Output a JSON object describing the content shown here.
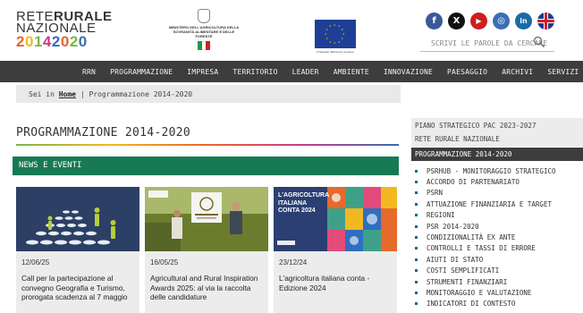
{
  "logo": {
    "line1a": "RETE",
    "line1b": "RURALE",
    "line2": "NAZIONALE",
    "digits": [
      "2",
      "0",
      "1",
      "4",
      "2",
      "0",
      "2",
      "0"
    ],
    "digit_colors": [
      "#e8662a",
      "#f2b821",
      "#7ab648",
      "#c83c8c",
      "#3a6cb4",
      "#e8662a",
      "#7ab648",
      "#3a6cb4"
    ]
  },
  "ministry": {
    "text": "MINISTERO DELL'AGRICOLTURA DELLA SOVRANITÀ ALIMENTARE E DELLE FORESTE"
  },
  "eu": {
    "caption": "Finanziato dall'Unione europea"
  },
  "social": {
    "facebook": "f",
    "x": "X",
    "youtube": "▶",
    "instagram": "◎",
    "linkedin": "in"
  },
  "search": {
    "placeholder": "SCRIVI LE PAROLE DA CERCARE"
  },
  "nav": [
    "RRN",
    "PROGRAMMAZIONE",
    "IMPRESA",
    "TERRITORIO",
    "LEADER",
    "AMBIENTE",
    "INNOVAZIONE",
    "PAESAGGIO",
    "ARCHIVI",
    "SERVIZI"
  ],
  "breadcrumb": {
    "prefix": "Sei in",
    "home": "Home",
    "current": "Programmazione 2014-2020"
  },
  "page_title": "PROGRAMMAZIONE 2014-2020",
  "news_header": "NEWS E EVENTI",
  "cards": [
    {
      "date": "12/06/25",
      "title": "Call per la partecipazione al convegno Geografia e Turismo, prorogata scadenza al 7 maggio"
    },
    {
      "date": "16/05/25",
      "title": "Agricultural and Rural Inspiration Awards 2025: al via la raccolta delle candidature",
      "badge": "ARIA"
    },
    {
      "date": "23/12/24",
      "title": "L'agricoltura italiana conta - Edizione 2024",
      "img_title": "L'AGRICOLTURA ITALIANA CONTA 2024"
    }
  ],
  "sidebar": {
    "top_links": [
      "PIANO STRATEGICO PAC 2023-2027",
      "RETE RURALE NAZIONALE"
    ],
    "section": "PROGRAMMAZIONE 2014-2020",
    "items": [
      "PSRHUB - MONITORAGGIO STRATEGICO",
      "ACCORDO DI PARTENARIATO",
      "PSRN",
      "ATTUAZIONE FINANZIARIA E TARGET",
      "REGIONI",
      "PSR 2014-2020",
      "CONDIZIONALITÀ EX ANTE",
      "CONTROLLI E TASSI DI ERRORE",
      "AIUTI DI STATO",
      "COSTI SEMPLIFICATI",
      "STRUMENTI FINANZIARI",
      "MONITORAGGIO E VALUTAZIONE",
      "INDICATORI DI CONTESTO"
    ]
  },
  "colors": {
    "nav_bg": "#3d3d3d",
    "news_bar": "#177a55",
    "facebook": "#3b5998",
    "x": "#111111",
    "youtube": "#cc1f1f",
    "instagram": "#3b6fb6",
    "linkedin": "#1a6aa8"
  }
}
